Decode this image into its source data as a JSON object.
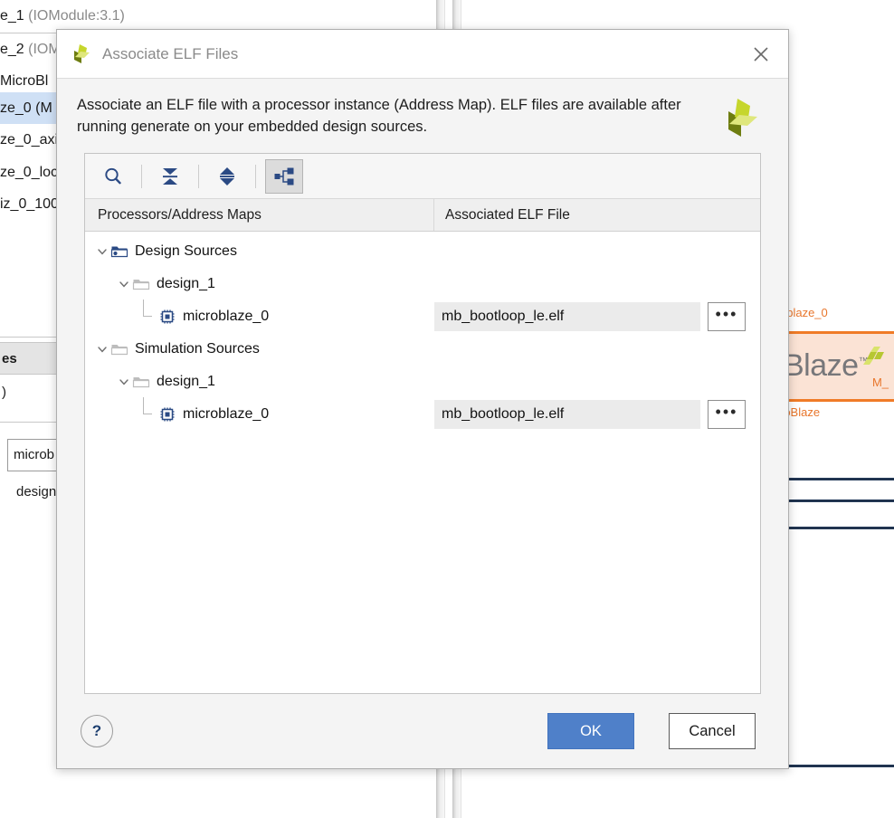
{
  "dialog": {
    "title": "Associate ELF Files",
    "logo_icon": "xilinx-logo-icon",
    "close_icon": "close-icon",
    "description": "Associate an ELF file with a processor instance (Address Map). ELF files are available after running generate on your embedded design sources.",
    "toolbar": [
      {
        "name": "search-icon",
        "label": "Search"
      },
      {
        "name": "collapse-all-icon",
        "label": "Collapse All"
      },
      {
        "name": "expand-all-icon",
        "label": "Expand All"
      },
      {
        "name": "hierarchy-icon",
        "label": "Show Hierarchy",
        "active": true
      }
    ],
    "columns": {
      "processors": "Processors/Address Maps",
      "elf": "Associated ELF File"
    },
    "rows": [
      {
        "label": "Design Sources",
        "icon": "folder-design-icon",
        "depth": 0,
        "expanded": true,
        "elf": null
      },
      {
        "label": "design_1",
        "icon": "folder-icon",
        "depth": 1,
        "expanded": true,
        "elf": null
      },
      {
        "label": "microblaze_0",
        "icon": "processor-chip-icon",
        "depth": 2,
        "expanded": null,
        "elf": "mb_bootloop_le.elf"
      },
      {
        "label": "Simulation Sources",
        "icon": "folder-icon",
        "depth": 0,
        "expanded": true,
        "elf": null
      },
      {
        "label": "design_1",
        "icon": "folder-icon",
        "depth": 1,
        "expanded": true,
        "elf": null
      },
      {
        "label": "microblaze_0",
        "icon": "processor-chip-icon",
        "depth": 2,
        "expanded": null,
        "elf": "mb_bootloop_le.elf"
      }
    ],
    "browse_label": "•••",
    "footer": {
      "help_label": "?",
      "ok_label": "OK",
      "cancel_label": "Cancel"
    },
    "colors": {
      "ok_button": "#4f80c9",
      "field_background": "#ebebeb",
      "title_text": "#8a8a8a",
      "icon_blue": "#2b4a84"
    }
  },
  "background": {
    "tree_rows": [
      {
        "text": "e_1 ",
        "suffix": "(IOModule:3.1)",
        "selected": false
      },
      {
        "text": "e_2 ",
        "suffix": "(IOM",
        "selected": false
      },
      {
        "text": "MicroBl",
        "suffix": "",
        "selected": false
      },
      {
        "text": "ze_0 ",
        "suffix": "(M",
        "selected": true
      },
      {
        "text": "ze_0_axi",
        "suffix": "",
        "selected": false
      },
      {
        "text": "ze_0_loc",
        "suffix": "",
        "selected": false
      },
      {
        "text": "iz_0_100",
        "suffix": "",
        "selected": false
      }
    ],
    "panel2": {
      "header": "es",
      "row1": ")",
      "boxed_value": "microb",
      "sub_value": "design"
    },
    "block_diagram": {
      "ip_name": "oblaze_0",
      "ip_type": "roBlaze",
      "ip_title": "Blaze",
      "ip_tm": "™",
      "ip_port": "M_",
      "accent_color": "#f07b27",
      "fill_color": "#fbe3d5"
    }
  }
}
